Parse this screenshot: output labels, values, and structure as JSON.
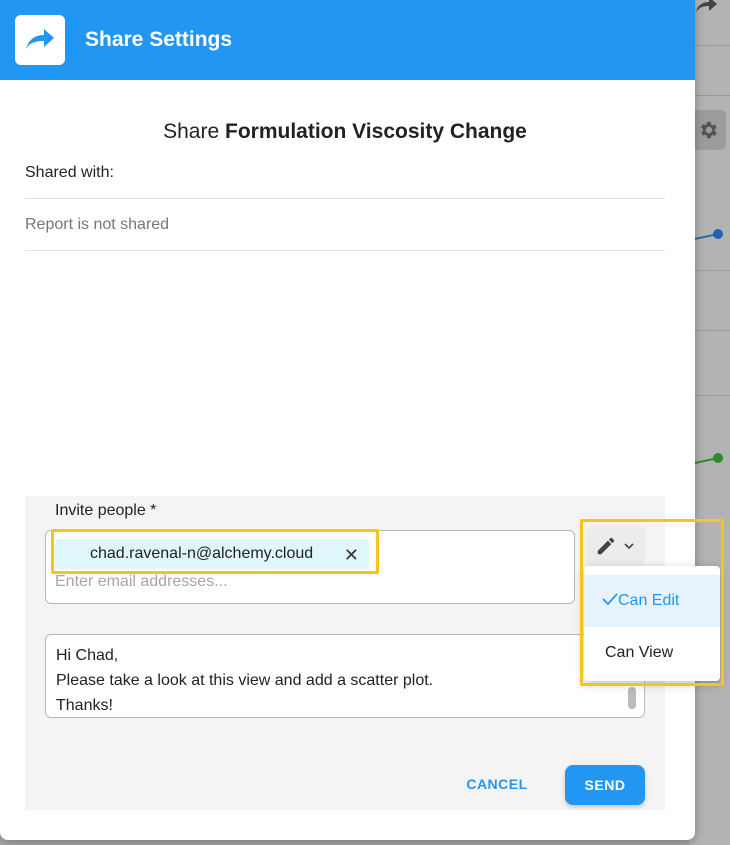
{
  "header": {
    "title": "Share Settings",
    "icon": "share-arrow-icon",
    "color": "#2196f3"
  },
  "share": {
    "prefix": "Share",
    "report_name": "Formulation Viscosity Change",
    "shared_with_label": "Shared with:",
    "not_shared_text": "Report is not shared"
  },
  "invite": {
    "label": "Invite people *",
    "chips": [
      "chad.ravenal-n@alchemy.cloud"
    ],
    "email_placeholder": "Enter email addresses...",
    "permission_icon": "pencil-icon",
    "permission_options": [
      {
        "label": "Can Edit",
        "selected": true
      },
      {
        "label": "Can View",
        "selected": false
      }
    ]
  },
  "message": {
    "lines": [
      "Hi Chad,",
      "Please take a look at this view and add a scatter plot.",
      "Thanks!"
    ]
  },
  "actions": {
    "cancel_label": "CANCEL",
    "send_label": "SEND"
  },
  "colors": {
    "accent": "#2196f3",
    "highlight": "#f5c518",
    "chip_bg": "#dff6fa"
  }
}
